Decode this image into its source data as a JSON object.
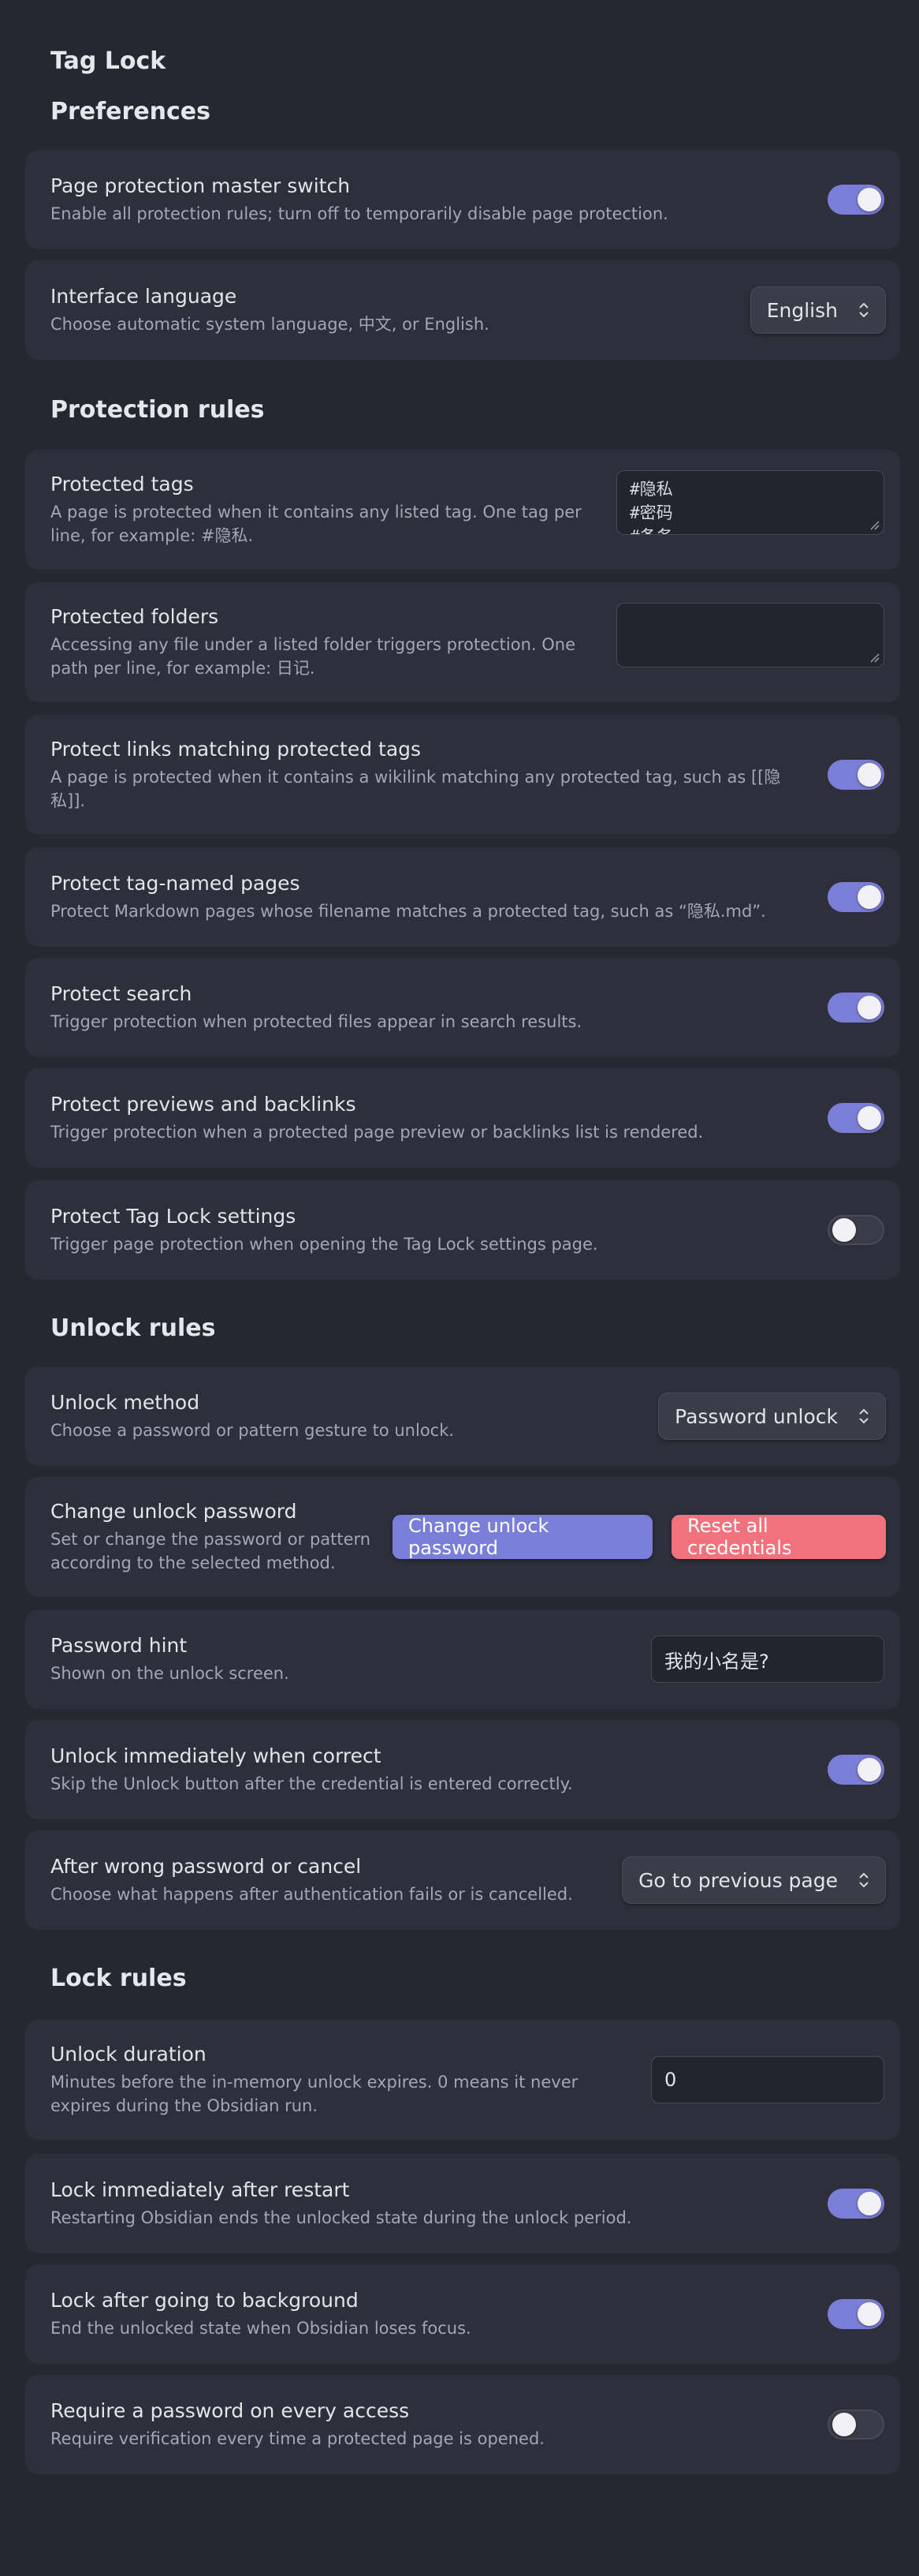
{
  "plugin_title": "Tag Lock",
  "sections": {
    "preferences": "Preferences",
    "protection": "Protection rules",
    "unlock": "Unlock rules",
    "lock": "Lock rules"
  },
  "settings": {
    "master_switch": {
      "name": "Page protection master switch",
      "desc": "Enable all protection rules; turn off to temporarily disable page protection.",
      "enabled": true
    },
    "interface_language": {
      "name": "Interface language",
      "desc": "Choose automatic system language, 中文, or English.",
      "value": "English"
    },
    "protected_tags": {
      "name": "Protected tags",
      "desc": "A page is protected when it contains any listed tag. One tag per line, for example: #隐私.",
      "lines": [
        "#隐私",
        "#密码",
        "#备务"
      ]
    },
    "protected_folders": {
      "name": "Protected folders",
      "desc": "Accessing any file under a listed folder triggers protection. One path per line, for example: 日记.",
      "value": ""
    },
    "protect_links": {
      "name": "Protect links matching protected tags",
      "desc": "A page is protected when it contains a wikilink matching any protected tag, such as [[隐私]].",
      "enabled": true
    },
    "protect_tag_named": {
      "name": "Protect tag-named pages",
      "desc": "Protect Markdown pages whose filename matches a protected tag, such as “隐私.md”.",
      "enabled": true
    },
    "protect_search": {
      "name": "Protect search",
      "desc": "Trigger protection when protected files appear in search results.",
      "enabled": true
    },
    "protect_previews": {
      "name": "Protect previews and backlinks",
      "desc": "Trigger protection when a protected page preview or backlinks list is rendered.",
      "enabled": true
    },
    "protect_settings": {
      "name": "Protect Tag Lock settings",
      "desc": "Trigger page protection when opening the Tag Lock settings page.",
      "enabled": false
    },
    "unlock_method": {
      "name": "Unlock method",
      "desc": "Choose a password or pattern gesture to unlock.",
      "value": "Password unlock"
    },
    "change_password": {
      "name": "Change unlock password",
      "desc": "Set or change the password or pattern according to the selected method.",
      "primary_label": "Change unlock password",
      "danger_label": "Reset all credentials"
    },
    "password_hint": {
      "name": "Password hint",
      "desc": "Shown on the unlock screen.",
      "value": "我的小名是?"
    },
    "unlock_immediately": {
      "name": "Unlock immediately when correct",
      "desc": "Skip the Unlock button after the credential is entered correctly.",
      "enabled": true
    },
    "after_wrong": {
      "name": "After wrong password or cancel",
      "desc": "Choose what happens after authentication fails or is cancelled.",
      "value": "Go to previous page"
    },
    "unlock_duration": {
      "name": "Unlock duration",
      "desc": "Minutes before the in-memory unlock expires. 0 means it never expires during the Obsidian run.",
      "value": "0"
    },
    "lock_restart": {
      "name": "Lock immediately after restart",
      "desc": "Restarting Obsidian ends the unlocked state during the unlock period.",
      "enabled": true
    },
    "lock_background": {
      "name": "Lock after going to background",
      "desc": "End the unlocked state when Obsidian loses focus.",
      "enabled": true
    },
    "require_every_access": {
      "name": "Require a password on every access",
      "desc": "Require verification every time a protected page is opened.",
      "enabled": false
    }
  },
  "colors": {
    "accent": "#7b7ed6",
    "danger": "#f1727c",
    "card": "#2e2f3a",
    "background": "#262731"
  }
}
